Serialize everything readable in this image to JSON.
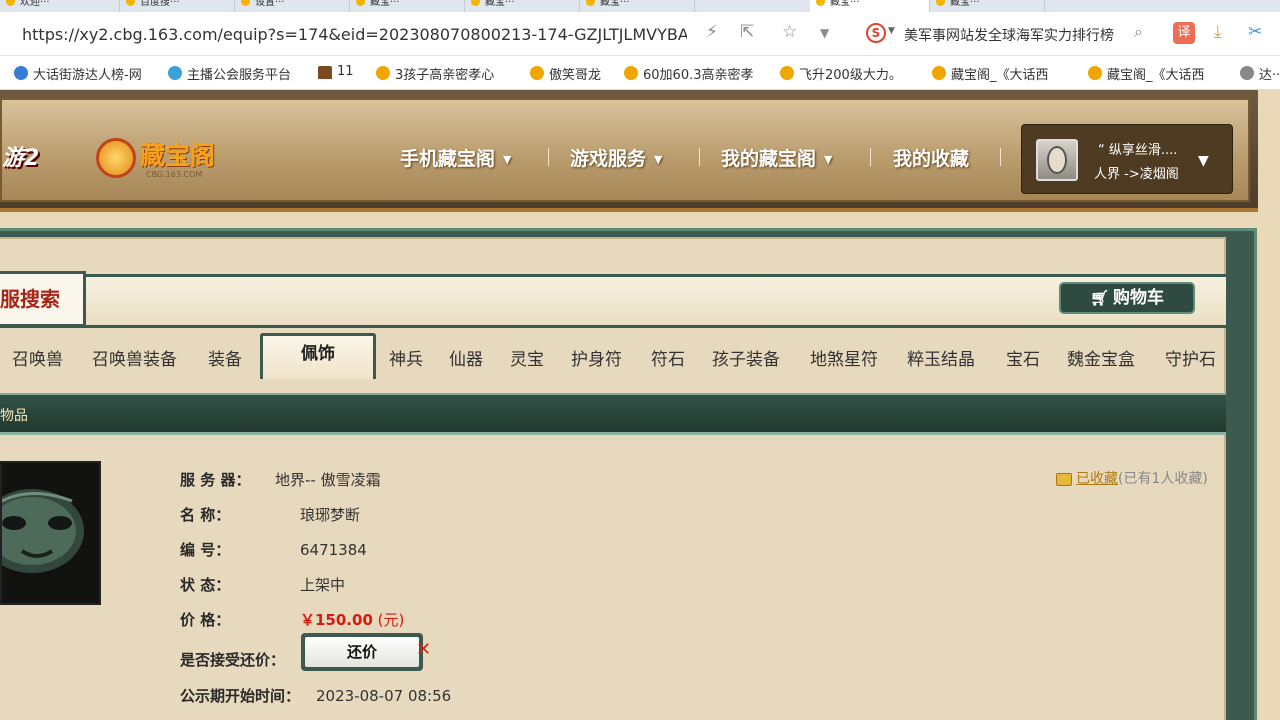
{
  "browser": {
    "tabs": [
      "欢迎···",
      "百度搜···",
      "设置···",
      "藏宝···",
      "藏宝···",
      "藏宝···",
      "藏宝···",
      "藏宝···"
    ],
    "url": "https://xy2.cbg.163.com/equip?s=174&eid=202308070800213-174-GZJLTJLMVYBA&c",
    "search_hint": "美军事网站发全球海军实力排行榜",
    "search_logo": "S",
    "translate_label": "译",
    "toolbar_icons": [
      "bolt-icon",
      "share-icon",
      "star-icon",
      "chevron-down-icon",
      "search-icon",
      "download-icon",
      "scissors-icon"
    ],
    "bookmarks": [
      "大话街游达人榜-网",
      "主播公会服务平台",
      "11",
      "3孩子高亲密孝心",
      "傲笑哥龙",
      "60加60.3高亲密孝",
      "飞升200级大力。",
      "藏宝阁_《大话西",
      "藏宝阁_《大话西",
      "达··"
    ]
  },
  "header": {
    "game_logo": "游2",
    "site_name": "藏宝阁",
    "site_sub": "CBG.163.COM",
    "nav": [
      "手机藏宝阁",
      "游戏服务",
      "我的藏宝阁",
      "我的收藏"
    ],
    "user": {
      "name": "“ 纵享丝滑....",
      "realm": "人界 ->凌烟阁"
    }
  },
  "search": {
    "label": "服搜索",
    "cart_label": "购物车"
  },
  "categories": [
    "召唤兽",
    "召唤兽装备",
    "装备",
    "佩饰",
    "神兵",
    "仙器",
    "灵宝",
    "护身符",
    "符石",
    "孩子装备",
    "地煞星符",
    "粹玉结晶",
    "宝石",
    "魏金宝盒",
    "守护石"
  ],
  "active_category": "佩饰",
  "items_title": "物品",
  "detail": {
    "server_k": "服 务 器：",
    "server_v": "地界-- 傲雪凌霜",
    "name_k": "名         称：",
    "name_v": "琅琊梦断",
    "id_k": "编         号：",
    "id_v": "6471384",
    "status_k": "状         态：",
    "status_v": "上架中",
    "price_k": "价         格：",
    "price_v": "￥150.00",
    "price_unit": "(元)",
    "counter_k": "是否接受还价：",
    "counter_btn": "还价",
    "public_k": "公示期开始时间：",
    "public_v": "2023-08-07 08:56",
    "fav_link": "已收藏",
    "fav_count": "(已有1人收藏)"
  }
}
